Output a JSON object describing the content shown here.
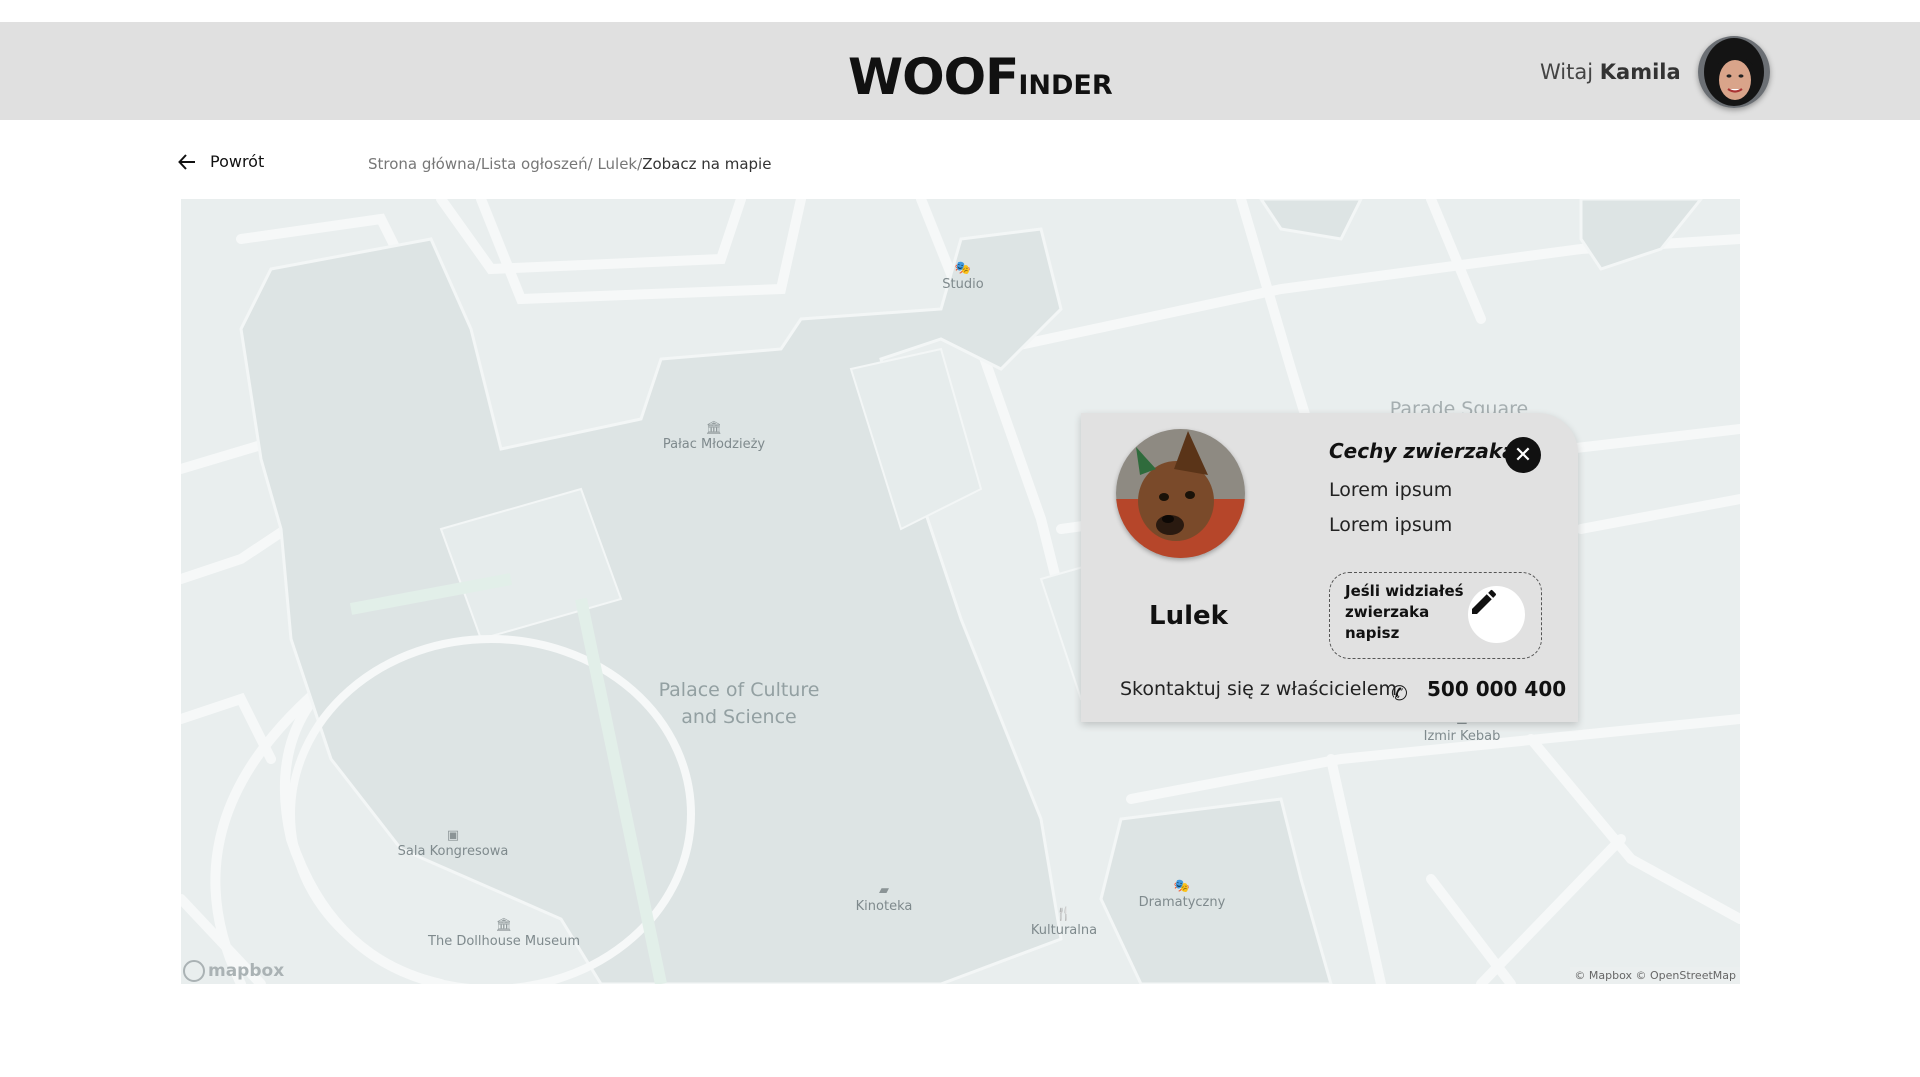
{
  "header": {
    "logo_big": "WOOF",
    "logo_small": "INDER",
    "greeting": "Witaj",
    "user_name": "Kamila"
  },
  "nav": {
    "back_label": "Powrót",
    "breadcrumbs": [
      "Strona główna/",
      "Lista ogłoszeń/",
      " Lulek/"
    ],
    "current_crumb": "Zobacz na mapie"
  },
  "map": {
    "pois": [
      {
        "label": "Studio",
        "icon": "theater-icon"
      },
      {
        "label": "Pałac Młodzieży",
        "icon": "museum-icon"
      },
      {
        "label": "Sala Kongresowa",
        "icon": "gallery-icon"
      },
      {
        "label": "The Dollhouse Museum",
        "icon": "museum-icon"
      },
      {
        "label": "Kinoteka",
        "icon": "cinema-icon"
      },
      {
        "label": "Kulturalna",
        "icon": "restaurant-icon"
      },
      {
        "label": "Dramatyczny",
        "icon": "theater-icon"
      },
      {
        "label": "Izmir Kebab",
        "icon": "fastfood-icon"
      }
    ],
    "landmark_line1": "Palace of Culture",
    "landmark_line2": "and Science",
    "square_label": "Parade Square",
    "provider": "mapbox",
    "attribution": "© Mapbox © OpenStreetMap"
  },
  "pet_card": {
    "name": "Lulek",
    "features_title": "Cechy zwierzaka:",
    "features": [
      "Lorem ipsum",
      "Lorem ipsum"
    ],
    "seen_prompt": "Jeśli widziałeś zwierzaka napisz",
    "contact_label": "Skontaktuj się z właścicielem",
    "phone": "500 000 400"
  },
  "colors": {
    "header_bg": "#e0e0e0",
    "map_bg": "#e9eeee",
    "card_bg": "#e1e1e1",
    "accent": "#111111"
  }
}
